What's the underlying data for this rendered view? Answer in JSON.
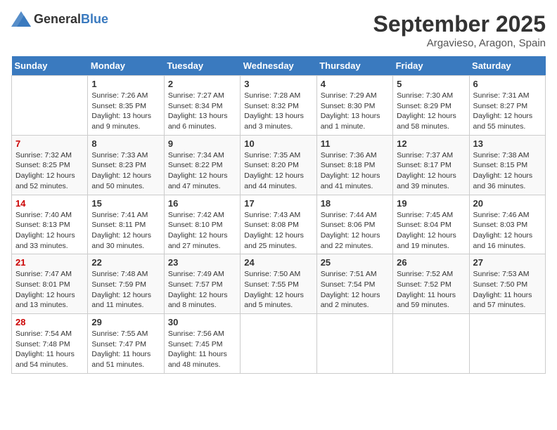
{
  "logo": {
    "general": "General",
    "blue": "Blue"
  },
  "title": "September 2025",
  "location": "Argavieso, Aragon, Spain",
  "weekdays": [
    "Sunday",
    "Monday",
    "Tuesday",
    "Wednesday",
    "Thursday",
    "Friday",
    "Saturday"
  ],
  "weeks": [
    [
      {
        "day": "",
        "info": ""
      },
      {
        "day": "1",
        "info": "Sunrise: 7:26 AM\nSunset: 8:35 PM\nDaylight: 13 hours and 9 minutes."
      },
      {
        "day": "2",
        "info": "Sunrise: 7:27 AM\nSunset: 8:34 PM\nDaylight: 13 hours and 6 minutes."
      },
      {
        "day": "3",
        "info": "Sunrise: 7:28 AM\nSunset: 8:32 PM\nDaylight: 13 hours and 3 minutes."
      },
      {
        "day": "4",
        "info": "Sunrise: 7:29 AM\nSunset: 8:30 PM\nDaylight: 13 hours and 1 minute."
      },
      {
        "day": "5",
        "info": "Sunrise: 7:30 AM\nSunset: 8:29 PM\nDaylight: 12 hours and 58 minutes."
      },
      {
        "day": "6",
        "info": "Sunrise: 7:31 AM\nSunset: 8:27 PM\nDaylight: 12 hours and 55 minutes."
      }
    ],
    [
      {
        "day": "7",
        "info": "Sunrise: 7:32 AM\nSunset: 8:25 PM\nDaylight: 12 hours and 52 minutes."
      },
      {
        "day": "8",
        "info": "Sunrise: 7:33 AM\nSunset: 8:23 PM\nDaylight: 12 hours and 50 minutes."
      },
      {
        "day": "9",
        "info": "Sunrise: 7:34 AM\nSunset: 8:22 PM\nDaylight: 12 hours and 47 minutes."
      },
      {
        "day": "10",
        "info": "Sunrise: 7:35 AM\nSunset: 8:20 PM\nDaylight: 12 hours and 44 minutes."
      },
      {
        "day": "11",
        "info": "Sunrise: 7:36 AM\nSunset: 8:18 PM\nDaylight: 12 hours and 41 minutes."
      },
      {
        "day": "12",
        "info": "Sunrise: 7:37 AM\nSunset: 8:17 PM\nDaylight: 12 hours and 39 minutes."
      },
      {
        "day": "13",
        "info": "Sunrise: 7:38 AM\nSunset: 8:15 PM\nDaylight: 12 hours and 36 minutes."
      }
    ],
    [
      {
        "day": "14",
        "info": "Sunrise: 7:40 AM\nSunset: 8:13 PM\nDaylight: 12 hours and 33 minutes."
      },
      {
        "day": "15",
        "info": "Sunrise: 7:41 AM\nSunset: 8:11 PM\nDaylight: 12 hours and 30 minutes."
      },
      {
        "day": "16",
        "info": "Sunrise: 7:42 AM\nSunset: 8:10 PM\nDaylight: 12 hours and 27 minutes."
      },
      {
        "day": "17",
        "info": "Sunrise: 7:43 AM\nSunset: 8:08 PM\nDaylight: 12 hours and 25 minutes."
      },
      {
        "day": "18",
        "info": "Sunrise: 7:44 AM\nSunset: 8:06 PM\nDaylight: 12 hours and 22 minutes."
      },
      {
        "day": "19",
        "info": "Sunrise: 7:45 AM\nSunset: 8:04 PM\nDaylight: 12 hours and 19 minutes."
      },
      {
        "day": "20",
        "info": "Sunrise: 7:46 AM\nSunset: 8:03 PM\nDaylight: 12 hours and 16 minutes."
      }
    ],
    [
      {
        "day": "21",
        "info": "Sunrise: 7:47 AM\nSunset: 8:01 PM\nDaylight: 12 hours and 13 minutes."
      },
      {
        "day": "22",
        "info": "Sunrise: 7:48 AM\nSunset: 7:59 PM\nDaylight: 12 hours and 11 minutes."
      },
      {
        "day": "23",
        "info": "Sunrise: 7:49 AM\nSunset: 7:57 PM\nDaylight: 12 hours and 8 minutes."
      },
      {
        "day": "24",
        "info": "Sunrise: 7:50 AM\nSunset: 7:55 PM\nDaylight: 12 hours and 5 minutes."
      },
      {
        "day": "25",
        "info": "Sunrise: 7:51 AM\nSunset: 7:54 PM\nDaylight: 12 hours and 2 minutes."
      },
      {
        "day": "26",
        "info": "Sunrise: 7:52 AM\nSunset: 7:52 PM\nDaylight: 11 hours and 59 minutes."
      },
      {
        "day": "27",
        "info": "Sunrise: 7:53 AM\nSunset: 7:50 PM\nDaylight: 11 hours and 57 minutes."
      }
    ],
    [
      {
        "day": "28",
        "info": "Sunrise: 7:54 AM\nSunset: 7:48 PM\nDaylight: 11 hours and 54 minutes."
      },
      {
        "day": "29",
        "info": "Sunrise: 7:55 AM\nSunset: 7:47 PM\nDaylight: 11 hours and 51 minutes."
      },
      {
        "day": "30",
        "info": "Sunrise: 7:56 AM\nSunset: 7:45 PM\nDaylight: 11 hours and 48 minutes."
      },
      {
        "day": "",
        "info": ""
      },
      {
        "day": "",
        "info": ""
      },
      {
        "day": "",
        "info": ""
      },
      {
        "day": "",
        "info": ""
      }
    ]
  ]
}
